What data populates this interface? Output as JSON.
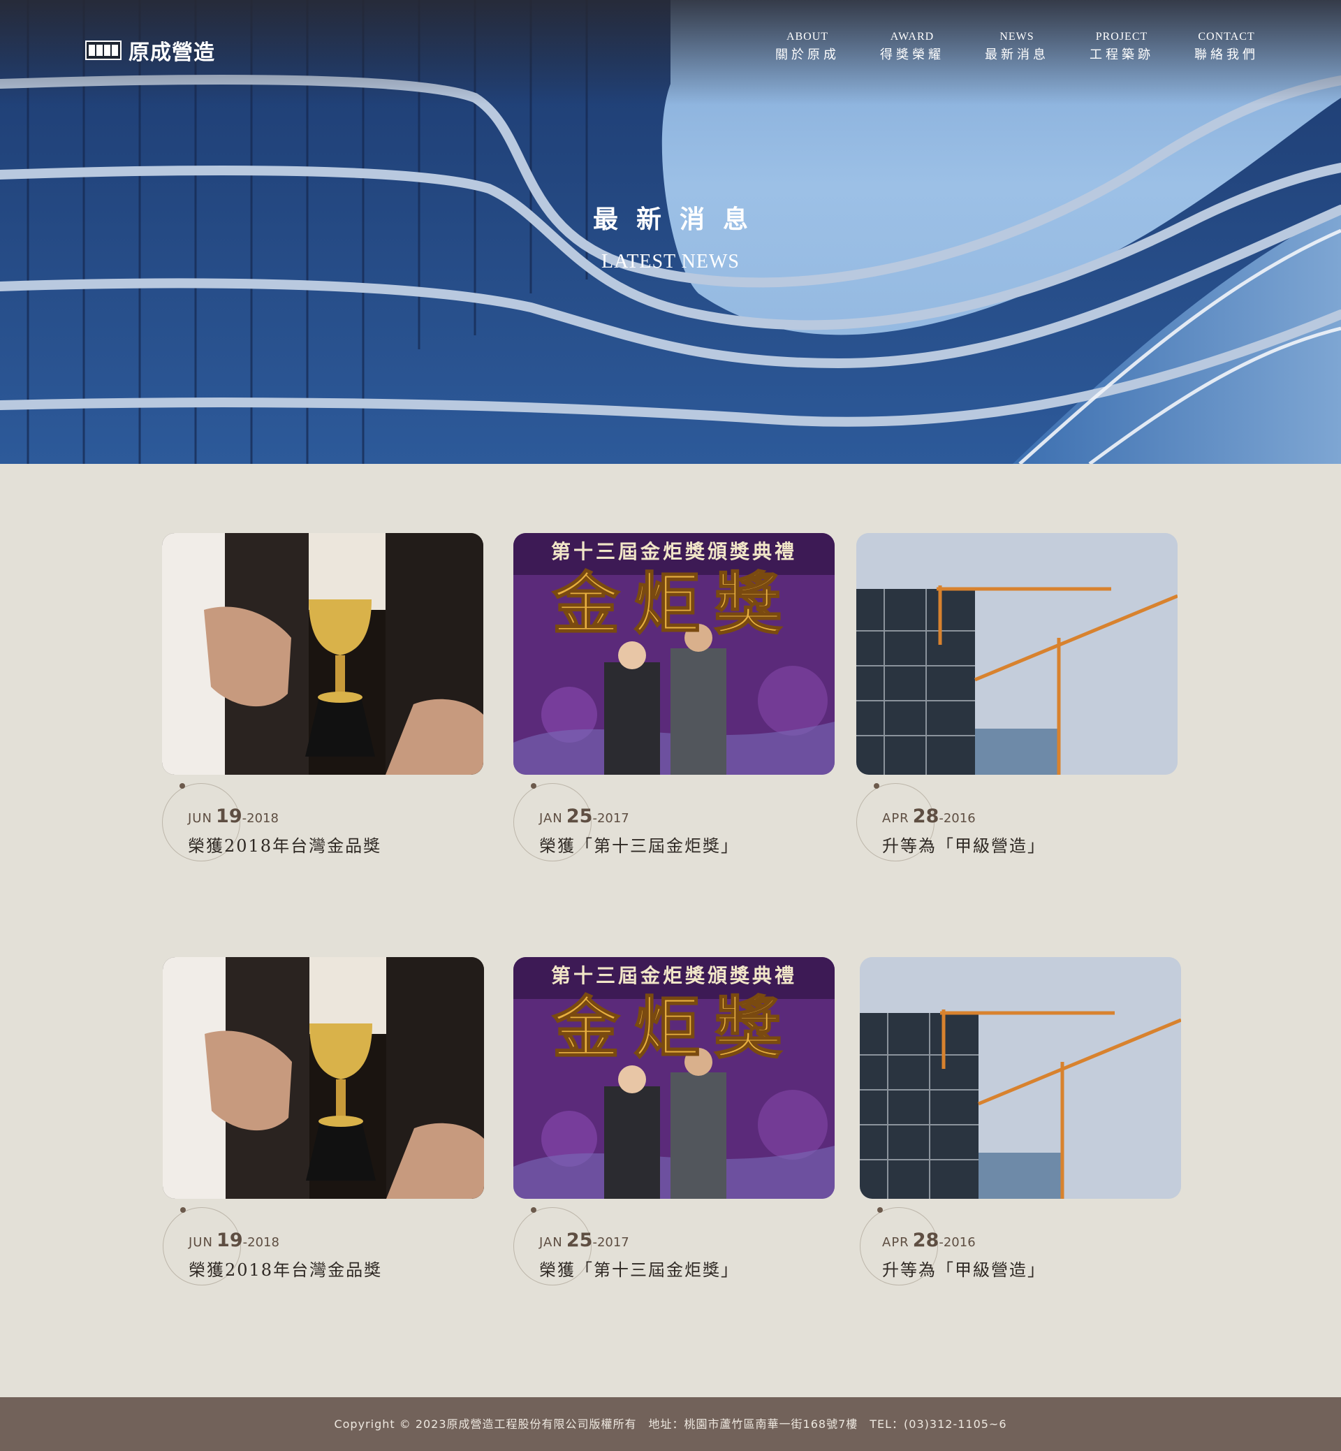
{
  "header": {
    "logo_text": "原成營造",
    "nav": [
      {
        "en": "ABOUT",
        "zh": "關於原成"
      },
      {
        "en": "AWARD",
        "zh": "得獎榮耀"
      },
      {
        "en": "NEWS",
        "zh": "最新消息"
      },
      {
        "en": "PROJECT",
        "zh": "工程築跡"
      },
      {
        "en": "CONTACT",
        "zh": "聯絡我們"
      }
    ]
  },
  "hero": {
    "title_zh": "最新消息",
    "title_en": "LATEST NEWS"
  },
  "news": [
    {
      "month": "JUN",
      "day": "19",
      "year": "-2018",
      "title": "榮獲2018年台灣金品獎",
      "image": "trophy-photo"
    },
    {
      "month": "JAN",
      "day": "25",
      "year": "-2017",
      "title": "榮獲「第十三屆金炬獎」",
      "image": "award-ceremony-photo",
      "banner_small": "第十三屆金炬獎頒獎典禮",
      "banner_big": "金炬獎"
    },
    {
      "month": "APR",
      "day": "28",
      "year": "-2016",
      "title": "升等為「甲級營造」",
      "image": "construction-crane-photo"
    },
    {
      "month": "JUN",
      "day": "19",
      "year": "-2018",
      "title": "榮獲2018年台灣金品獎",
      "image": "trophy-photo"
    },
    {
      "month": "JAN",
      "day": "25",
      "year": "-2017",
      "title": "榮獲「第十三屆金炬獎」",
      "image": "award-ceremony-photo",
      "banner_small": "第十三屆金炬獎頒獎典禮",
      "banner_big": "金炬獎"
    },
    {
      "month": "APR",
      "day": "28",
      "year": "-2016",
      "title": "升等為「甲級營造」",
      "image": "construction-crane-photo"
    }
  ],
  "footer": {
    "text": "Copyright © 2023原成營造工程股份有限公司版權所有　地址：桃園市蘆竹區南華一街168號7樓　TEL：(03)312-1105~6"
  },
  "colors": {
    "page_bg": "#e3e0d7",
    "footer_bg": "#72625a",
    "accent_brown": "#5e4e42"
  }
}
